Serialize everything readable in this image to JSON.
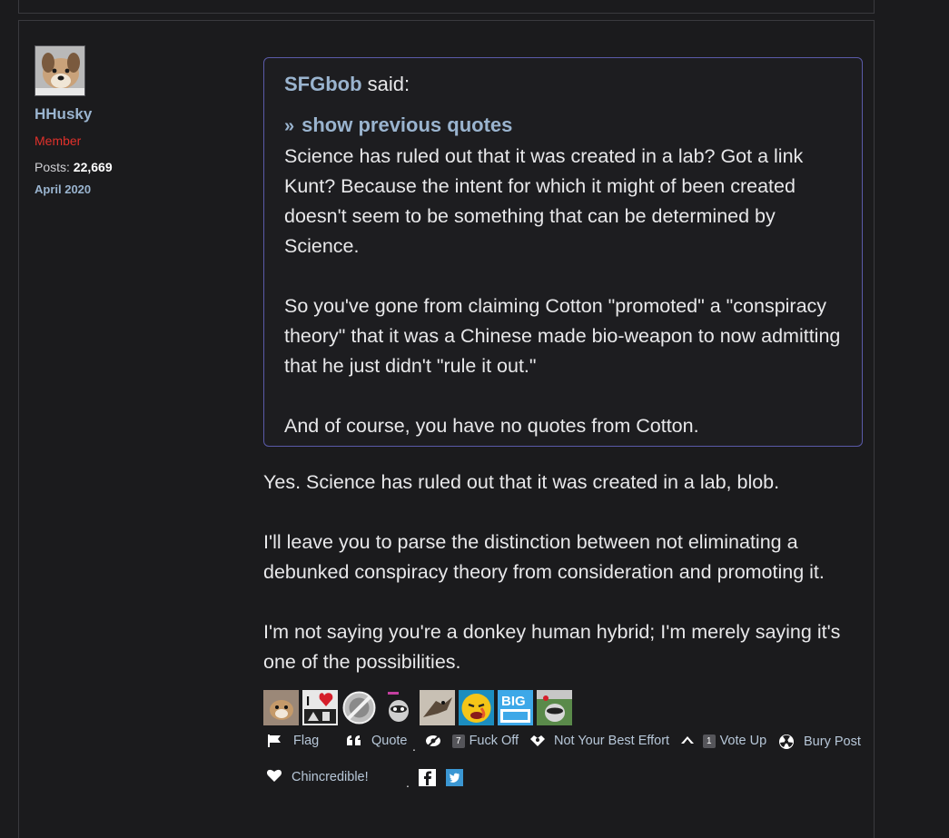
{
  "user": {
    "name": "HHusky",
    "role": "Member",
    "posts_label": "Posts:",
    "posts_count": "22,669",
    "joined": "April 2020"
  },
  "quote": {
    "author": "SFGbob",
    "said": " said:",
    "show_previous": "show previous quotes",
    "paragraphs": [
      "Science has ruled out that it was created in a lab? Got a link Kunt? Because the intent for which it might of been created doesn't seem to be something that can be determined by Science.",
      "So you've gone from claiming Cotton \"promoted\" a \"conspiracy theory\" that it was a Chinese made bio-weapon to now admitting that he just didn't \"rule it out.\"",
      "And of course, you have no quotes from Cotton."
    ]
  },
  "reply": {
    "paragraphs": [
      "Yes. Science has ruled out that it was created in a lab, blob.",
      "I'll leave you to parse the distinction between not eliminating a debunked conspiracy theory from consideration and promoting it.",
      "I'm not saying you're a donkey human hybrid; I'm merely saying it's one of the possibilities."
    ]
  },
  "reactions": [
    {
      "icon": "dog-reaction-icon",
      "text": ""
    },
    {
      "icon": "i-heart-reaction-icon",
      "text": "I"
    },
    {
      "icon": "no-symbol-reaction-icon",
      "text": ""
    },
    {
      "icon": "raccoon-reaction-icon",
      "text": ""
    },
    {
      "icon": "bird-reaction-icon",
      "text": ""
    },
    {
      "icon": "sad-face-reaction-icon",
      "text": ""
    },
    {
      "icon": "big-reaction-icon",
      "text": "BIG"
    },
    {
      "icon": "raccoon-flag-reaction-icon",
      "text": ""
    }
  ],
  "actions": {
    "flag": "Flag",
    "quote": "Quote",
    "fuck_off_count": "7",
    "fuck_off": "Fuck Off",
    "not_best_effort": "Not Your Best Effort",
    "vote_up_count": "1",
    "vote_up": "Vote Up",
    "bury_post": "Bury Post",
    "chincredible": "Chincredible!"
  },
  "colors": {
    "background": "#1b1b1d",
    "link": "#9ab4cf",
    "member_role": "#e0312b",
    "quote_border": "#5a5aa8"
  }
}
